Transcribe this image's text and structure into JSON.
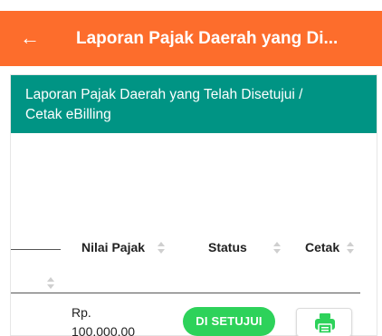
{
  "appbar": {
    "back_icon": "arrow-left-icon",
    "title": "Laporan Pajak Daerah yang Di..."
  },
  "card": {
    "header_line1": "Laporan Pajak Daerah yang Telah Disetujui /",
    "header_line2": "Cetak eBilling"
  },
  "table": {
    "columns": [
      "Nilai Pajak",
      "Status",
      "Cetak"
    ],
    "rows": [
      {
        "nilai_line1": "Rp.",
        "nilai_line2": "100.000,00",
        "status": "DI SETUJUI",
        "cetak_icon": "print-icon"
      }
    ]
  },
  "colors": {
    "appbar": "#fd6d2c",
    "card_header": "#009484",
    "status_badge": "#2dd25a",
    "print_icon": "#2dd25a"
  }
}
